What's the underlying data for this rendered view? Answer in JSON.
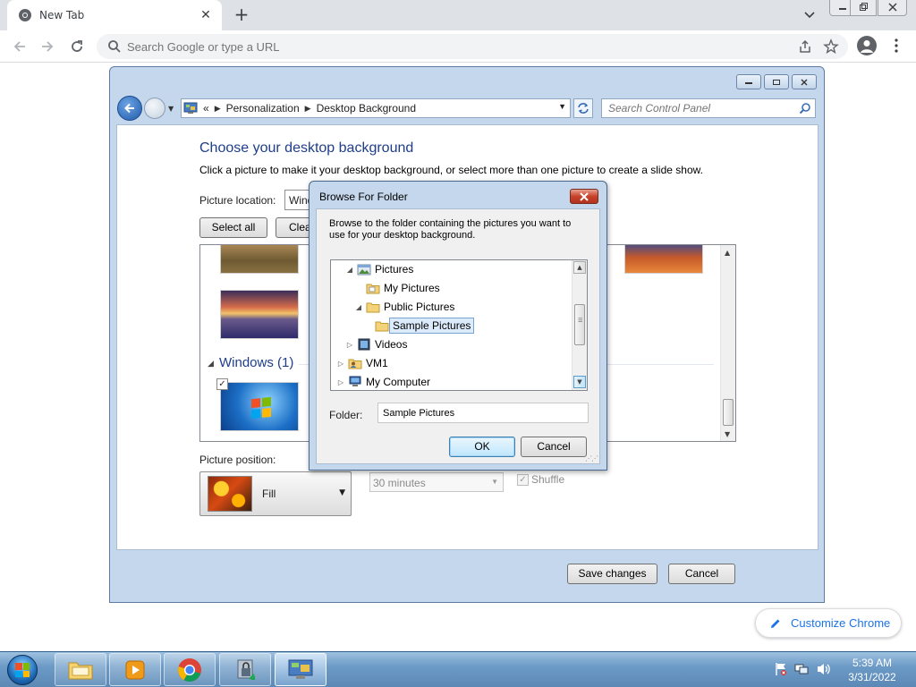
{
  "browser": {
    "tab_title": "New Tab",
    "omnibox_placeholder": "Search Google or type a URL",
    "customize_label": "Customize Chrome"
  },
  "control_panel": {
    "breadcrumb": {
      "overflow": "«",
      "items": [
        "Personalization",
        "Desktop Background"
      ]
    },
    "search_placeholder": "Search Control Panel",
    "heading": "Choose your desktop background",
    "subtitle": "Click a picture to make it your desktop background, or select more than one picture to create a slide show.",
    "picture_location_label": "Picture location:",
    "picture_location_value": "Windows Desktop Backgrounds",
    "select_all_label": "Select all",
    "clear_all_label": "Clear all",
    "group_title": "Windows (1)",
    "picture_position_label": "Picture position:",
    "picture_position_value": "Fill",
    "interval_value": "30 minutes",
    "shuffle_label": "Shuffle",
    "save_label": "Save changes",
    "cancel_label": "Cancel"
  },
  "dialog": {
    "title": "Browse For Folder",
    "description": "Browse to the folder containing the pictures you want to use for your desktop background.",
    "tree": [
      {
        "label": "Pictures",
        "expander": "◢",
        "icon": "pictures-library-icon"
      },
      {
        "label": "My Pictures",
        "expander": "",
        "icon": "folder-icon"
      },
      {
        "label": "Public Pictures",
        "expander": "◢",
        "icon": "folder-icon"
      },
      {
        "label": "Sample Pictures",
        "expander": "",
        "icon": "folder-icon",
        "selected": true
      },
      {
        "label": "Videos",
        "expander": "▷",
        "icon": "videos-library-icon"
      },
      {
        "label": "VM1",
        "expander": "▷",
        "icon": "user-folder-icon"
      },
      {
        "label": "My Computer",
        "expander": "▷",
        "icon": "computer-icon"
      }
    ],
    "folder_label": "Folder:",
    "folder_value": "Sample Pictures",
    "ok_label": "OK",
    "cancel_label": "Cancel"
  },
  "taskbar": {
    "apps": [
      "file-explorer",
      "media-player",
      "chrome",
      "security-tool",
      "control-panel"
    ],
    "time": "5:39 AM",
    "date": "3/31/2022"
  }
}
